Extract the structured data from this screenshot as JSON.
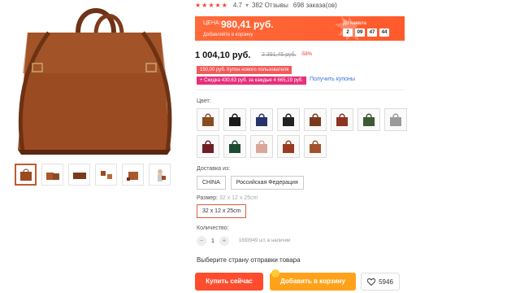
{
  "rating": {
    "value": "4.7",
    "stars_glyph": "★★★★★",
    "reviews": "382 Отзывы",
    "orders": "698 заказа(ов)"
  },
  "promo": {
    "price_label": "ЦЕНА:",
    "price_value": "980,41 руб.",
    "cart_note": "Добавляйте в корзину",
    "timer_label": "До начала",
    "timer": [
      "2",
      "09",
      "47",
      "44"
    ]
  },
  "price": {
    "current": "1 004,10 руб.",
    "old": "2 391,45 руб.",
    "discount": "-58%"
  },
  "coupons": {
    "new_user": "150,00 руб. Купон нового пользователя",
    "discount": "+ Скидка 430,63 руб. за каждые 4 665,19 руб.",
    "get_link": "Получить купоны"
  },
  "color_label": "Цвет:",
  "colors": [
    {
      "name": "brown",
      "hex": "#8a4a22"
    },
    {
      "name": "black",
      "hex": "#1a1a1a"
    },
    {
      "name": "navy",
      "hex": "#26336b"
    },
    {
      "name": "dark",
      "hex": "#222222"
    },
    {
      "name": "brown2",
      "hex": "#7a3a1c"
    },
    {
      "name": "red-brown",
      "hex": "#8d3324"
    },
    {
      "name": "green",
      "hex": "#3d5a32"
    },
    {
      "name": "grey",
      "hex": "#9a9a9a"
    },
    {
      "name": "wine",
      "hex": "#6d1f26"
    },
    {
      "name": "dark-green",
      "hex": "#1e4a34"
    },
    {
      "name": "pink",
      "hex": "#d8a79a"
    },
    {
      "name": "rust",
      "hex": "#9a3a22"
    },
    {
      "name": "caramel",
      "hex": "#a1522a"
    }
  ],
  "shipping": {
    "label": "Доставка из:",
    "options": [
      "CHINA",
      "Российская Федерация"
    ]
  },
  "size": {
    "label": "Размер:",
    "value_hint": "32 x 12 x 25cm",
    "selected": "32 x 12 x 25cm"
  },
  "quantity": {
    "label": "Количество:",
    "minus": "−",
    "value": "1",
    "plus": "+",
    "stock": "1693949 шт. в наличии"
  },
  "ship_country": "Выберите страну отправки товара",
  "actions": {
    "buy_now": "Купить сейчас",
    "add_cart": "Добавить в корзину",
    "wish_count": "5946"
  },
  "theme": {
    "accent": "#ff4c2e",
    "cart": "#ffa21a",
    "bag": "#9a4b22"
  }
}
